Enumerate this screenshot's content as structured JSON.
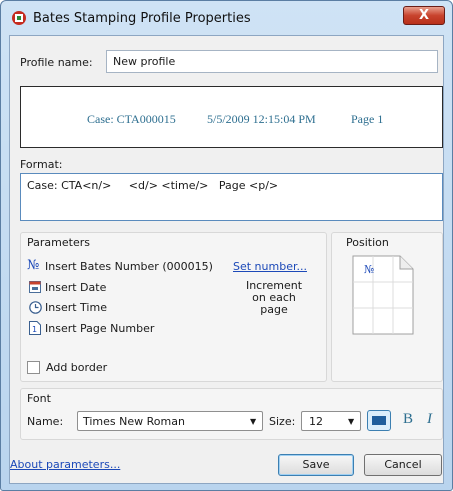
{
  "window": {
    "title": "Bates Stamping Profile Properties",
    "close_glyph": "X"
  },
  "profile": {
    "label": "Profile name:",
    "value": "New profile"
  },
  "preview": {
    "case": "Case: CTA000015",
    "datetime": "5/5/2009 12:15:04 PM",
    "page": "Page 1"
  },
  "format": {
    "label": "Format:",
    "value": "Case: CTA<n/>     <d/> <time/>   Page <p/>"
  },
  "parameters": {
    "title": "Parameters",
    "bates": "Insert Bates Number (000015)",
    "bates_icon_glyph": "№",
    "set_number": "Set number...",
    "date": "Insert Date",
    "time": "Insert Time",
    "page_number": "Insert Page Number",
    "increment_note": [
      "Increment",
      "on each",
      "page"
    ],
    "add_border": "Add border"
  },
  "position": {
    "title": "Position",
    "glyph": "№"
  },
  "font": {
    "title": "Font",
    "name_label": "Name:",
    "name_value": "Times New Roman",
    "size_label": "Size:",
    "size_value": "12",
    "bold_glyph": "B",
    "italic_glyph": "I"
  },
  "footer": {
    "about": "About parameters...",
    "save": "Save",
    "cancel": "Cancel"
  },
  "colors": {
    "accent": "#2e6f90",
    "link": "#1c49b8",
    "close": "#c8432d"
  }
}
